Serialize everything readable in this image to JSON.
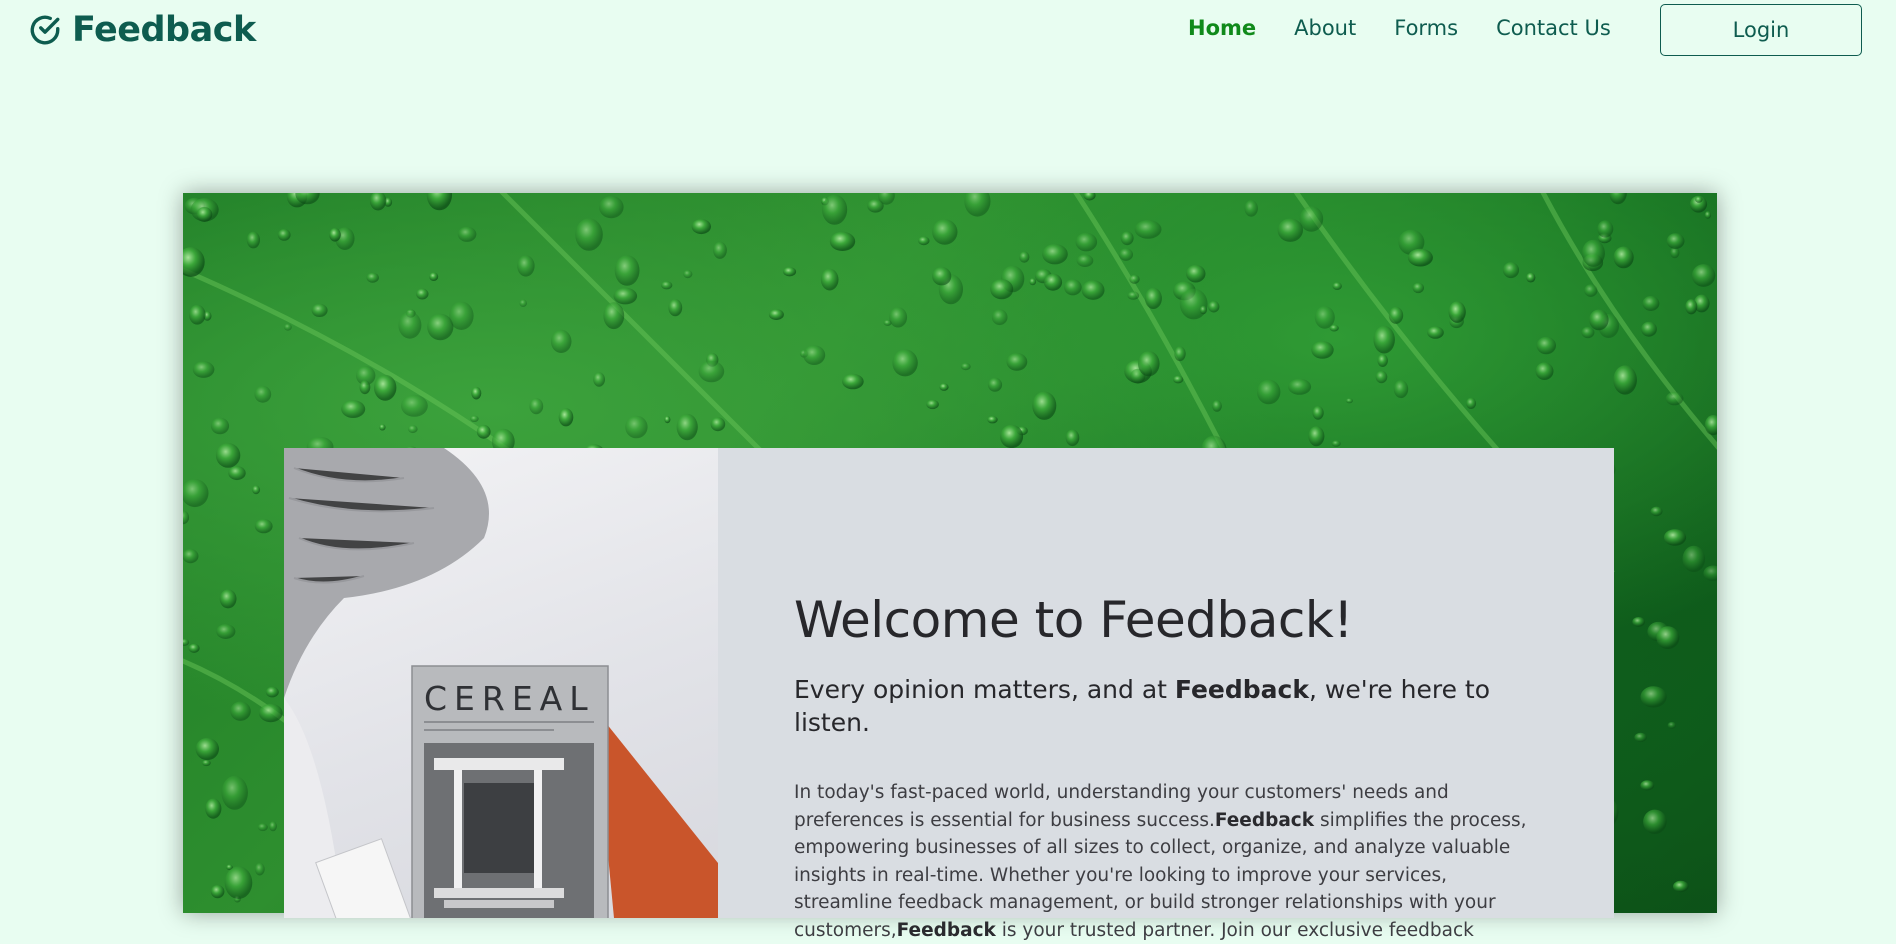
{
  "brand": {
    "name": "Feedback",
    "icon": "check-circle-icon"
  },
  "nav": {
    "items": [
      {
        "label": "Home",
        "active": true
      },
      {
        "label": "About",
        "active": false
      },
      {
        "label": "Forms",
        "active": false
      },
      {
        "label": "Contact Us",
        "active": false
      }
    ],
    "login_label": "Login"
  },
  "hero": {
    "magazine_title": "CEREAL",
    "title": "Welcome to Feedback!",
    "subtitle_pre": "Every opinion matters, and at ",
    "subtitle_brand": "Feedback",
    "subtitle_post": ", we're here to listen.",
    "body_1": "In today's fast-paced world, understanding your customers' needs and preferences is essential for business success.",
    "body_brand_1": "Feedback",
    "body_2": " simplifies the process, empowering businesses of all sizes to collect, organize, and analyze valuable insights in real-time. Whether you're looking to improve your services, streamline feedback management, or build stronger relationships with your customers,",
    "body_brand_2": "Feedback",
    "body_3": " is your trusted partner.  Join our exclusive feedback"
  },
  "colors": {
    "page_bg": "#e8fdf1",
    "brand": "#0e5c4f",
    "nav_active": "#108a1b",
    "card_bg": "#d9dde2"
  }
}
